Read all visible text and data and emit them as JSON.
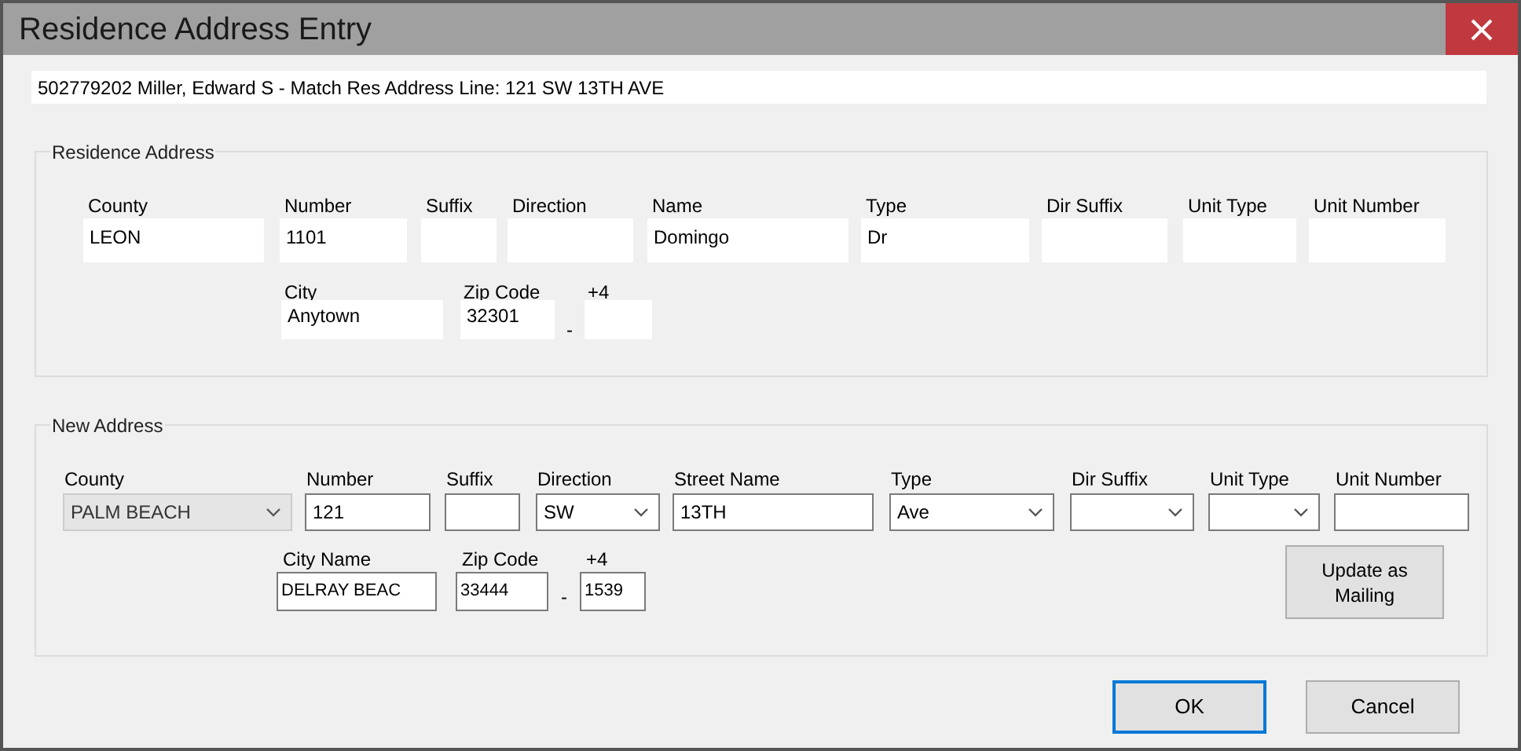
{
  "window": {
    "title": "Residence Address Entry"
  },
  "info_line": "502779202 Miller, Edward S - Match Res Address Line: 121 SW 13TH AVE",
  "residence_address": {
    "title": "Residence Address",
    "fields": [
      {
        "label": "County",
        "value": "LEON"
      },
      {
        "label": "Number",
        "value": "1101"
      },
      {
        "label": "Suffix"
      },
      {
        "label": "Direction"
      },
      {
        "label": "Name",
        "value": "Domingo"
      },
      {
        "label": "Type",
        "value": "Dr"
      },
      {
        "label": "Dir Suffix"
      },
      {
        "label": "Unit Type"
      },
      {
        "label": "Unit Number"
      }
    ],
    "location_fields": [
      {
        "label": "City",
        "value": "Anytown"
      },
      {
        "label": "Zip Code",
        "value": "32301"
      },
      {
        "label": "+4"
      }
    ],
    "zip_separator": "-"
  },
  "new_address": {
    "title": "New Address",
    "fields": [
      {
        "label": "County",
        "value": "PALM BEACH",
        "kind": "combo",
        "disabled": true
      },
      {
        "label": "Number",
        "value": "121",
        "kind": "text",
        "disabled": false
      },
      {
        "label": "Suffix",
        "kind": "text",
        "disabled": false
      },
      {
        "label": "Direction",
        "value": "SW",
        "kind": "combo",
        "disabled": false
      },
      {
        "label": "Street Name",
        "value": "13TH",
        "kind": "text",
        "disabled": false
      },
      {
        "label": "Type",
        "value": "Ave",
        "kind": "combo",
        "disabled": false
      },
      {
        "label": "Dir Suffix",
        "kind": "combo",
        "disabled": false
      },
      {
        "label": "Unit Type",
        "kind": "combo",
        "disabled": false
      },
      {
        "label": "Unit Number",
        "kind": "text",
        "disabled": false
      }
    ],
    "location_fields": [
      {
        "label": "City Name",
        "value": "DELRAY BEAC"
      },
      {
        "label": "Zip Code",
        "value": "33444"
      },
      {
        "label": "+4",
        "value": "1539"
      }
    ],
    "zip_separator": "-",
    "update_button": "Update as Mailing"
  },
  "buttons": [
    {
      "label": "OK",
      "default": true
    },
    {
      "label": "Cancel",
      "default": false
    }
  ]
}
